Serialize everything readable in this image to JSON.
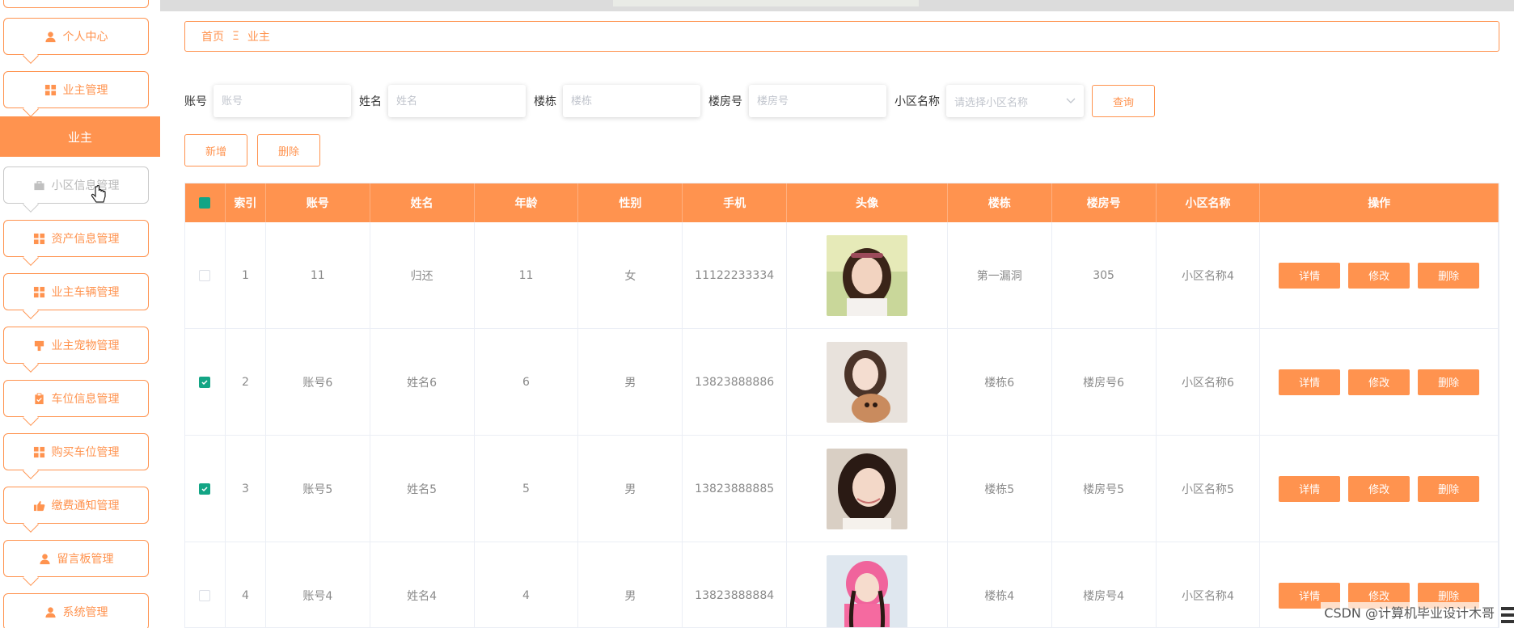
{
  "sidebar": {
    "active": "业主",
    "items": [
      {
        "label": "个人中心",
        "icon": "user-icon"
      },
      {
        "label": "业主管理",
        "icon": "grid-icon"
      },
      {
        "label": "小区信息管理",
        "icon": "bag-icon"
      },
      {
        "label": "资产信息管理",
        "icon": "grid-icon"
      },
      {
        "label": "业主车辆管理",
        "icon": "grid-icon"
      },
      {
        "label": "业主宠物管理",
        "icon": "flag-icon"
      },
      {
        "label": "车位信息管理",
        "icon": "clipboard-icon"
      },
      {
        "label": "购买车位管理",
        "icon": "grid-icon"
      },
      {
        "label": "缴费通知管理",
        "icon": "thumb-icon"
      },
      {
        "label": "留言板管理",
        "icon": "user-icon"
      },
      {
        "label": "系统管理",
        "icon": "user-icon"
      }
    ]
  },
  "breadcrumb": {
    "home": "首页",
    "separator": "Ξ",
    "current": "业主"
  },
  "search": {
    "account_label": "账号",
    "account_placeholder": "账号",
    "name_label": "姓名",
    "name_placeholder": "姓名",
    "building_label": "楼栋",
    "building_placeholder": "楼栋",
    "room_label": "楼房号",
    "room_placeholder": "楼房号",
    "community_label": "小区名称",
    "community_placeholder": "请选择小区名称",
    "query_button": "查询"
  },
  "actions": {
    "add": "新增",
    "delete": "删除"
  },
  "table": {
    "headers": [
      "索引",
      "账号",
      "姓名",
      "年龄",
      "性别",
      "手机",
      "头像",
      "楼栋",
      "楼房号",
      "小区名称",
      "操作"
    ],
    "rows": [
      {
        "checked": false,
        "index": "1",
        "account": "11",
        "name": "归还",
        "age": "11",
        "gender": "女",
        "phone": "11122233334",
        "building": "第一漏洞",
        "room": "305",
        "community": "小区名称4"
      },
      {
        "checked": true,
        "index": "2",
        "account": "账号6",
        "name": "姓名6",
        "age": "6",
        "gender": "男",
        "phone": "13823888886",
        "building": "楼栋6",
        "room": "楼房号6",
        "community": "小区名称6"
      },
      {
        "checked": true,
        "index": "3",
        "account": "账号5",
        "name": "姓名5",
        "age": "5",
        "gender": "男",
        "phone": "13823888885",
        "building": "楼栋5",
        "room": "楼房号5",
        "community": "小区名称5"
      },
      {
        "checked": false,
        "index": "4",
        "account": "账号4",
        "name": "姓名4",
        "age": "4",
        "gender": "男",
        "phone": "13823888884",
        "building": "楼栋4",
        "room": "楼房号4",
        "community": "小区名称4"
      }
    ],
    "row_actions": {
      "detail": "详情",
      "edit": "修改",
      "delete": "删除"
    }
  },
  "watermark": "CSDN @计算机毕业设计木哥",
  "colors": {
    "accent": "#ff934f",
    "checkbox": "#13a585"
  }
}
